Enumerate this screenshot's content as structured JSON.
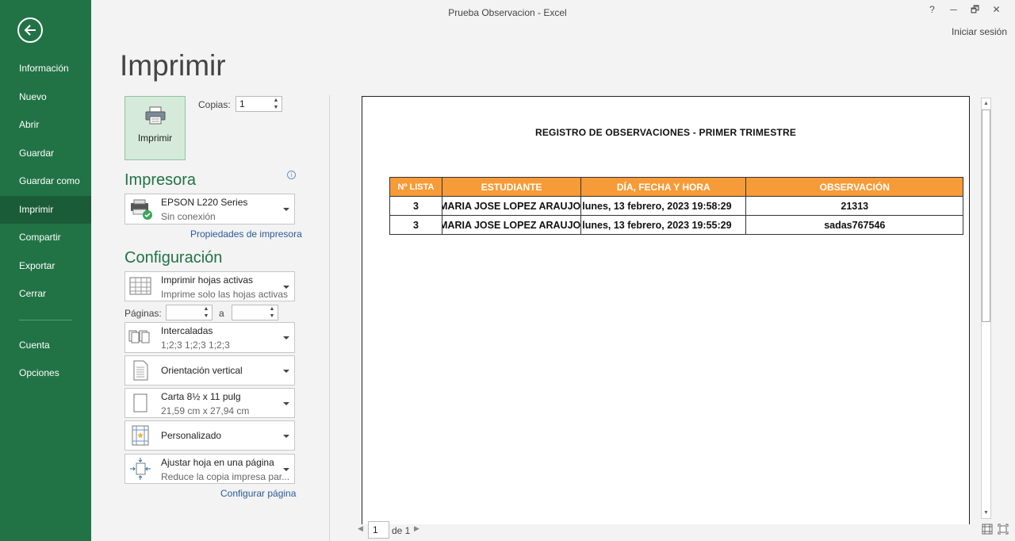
{
  "window": {
    "title": "Prueba Observacion - Excel",
    "help": "?",
    "minimize": "─",
    "restore": "🗗",
    "close": "✕",
    "signin": "Iniciar sesión"
  },
  "sidebar": {
    "items": [
      {
        "label": "Información"
      },
      {
        "label": "Nuevo"
      },
      {
        "label": "Abrir"
      },
      {
        "label": "Guardar"
      },
      {
        "label": "Guardar como"
      },
      {
        "label": "Imprimir",
        "active": true
      },
      {
        "label": "Compartir"
      },
      {
        "label": "Exportar"
      },
      {
        "label": "Cerrar"
      }
    ],
    "bottom_items": [
      {
        "label": "Cuenta"
      },
      {
        "label": "Opciones"
      }
    ],
    "accent": "#217346"
  },
  "print": {
    "heading": "Imprimir",
    "button_label": "Imprimir",
    "copies_label": "Copias:",
    "copies_value": "1",
    "printer_heading": "Impresora",
    "printer_name": "EPSON L220 Series",
    "printer_status": "Sin conexión",
    "printer_props_link": "Propiedades de impresora",
    "config_heading": "Configuración",
    "what": {
      "t1": "Imprimir hojas activas",
      "t2": "Imprime solo las hojas activas"
    },
    "pages_label": "Páginas:",
    "pages_from": "",
    "pages_to_label": "a",
    "pages_to": "",
    "collate": {
      "t1": "Intercaladas",
      "t2": "1;2;3    1;2;3    1;2;3"
    },
    "orientation": {
      "t1": "Orientación vertical"
    },
    "paper": {
      "t1": "Carta 8½ x 11 pulg",
      "t2": "21,59 cm x 27,94 cm"
    },
    "margins": {
      "t1": "Personalizado"
    },
    "scaling": {
      "t1": "Ajustar hoja en una página",
      "t2": "Reduce la copia impresa par..."
    },
    "page_setup_link": "Configurar página"
  },
  "preview": {
    "doc_title": "REGISTRO DE OBSERVACIONES - PRIMER TRIMESTRE",
    "headers": [
      "Nº LISTA",
      "ESTUDIANTE",
      "DÍA, FECHA Y HORA",
      "OBSERVACIÓN"
    ],
    "rows": [
      [
        "3",
        "MARIA JOSE LOPEZ ARAUJO",
        "lunes, 13 febrero, 2023  19:58:29",
        "21313"
      ],
      [
        "3",
        "MARIA JOSE LOPEZ ARAUJO",
        "lunes, 13 febrero, 2023  19:55:29",
        "sadas767546"
      ]
    ],
    "header_color": "#f79b38",
    "page_current": "1",
    "page_of": "de 1"
  }
}
